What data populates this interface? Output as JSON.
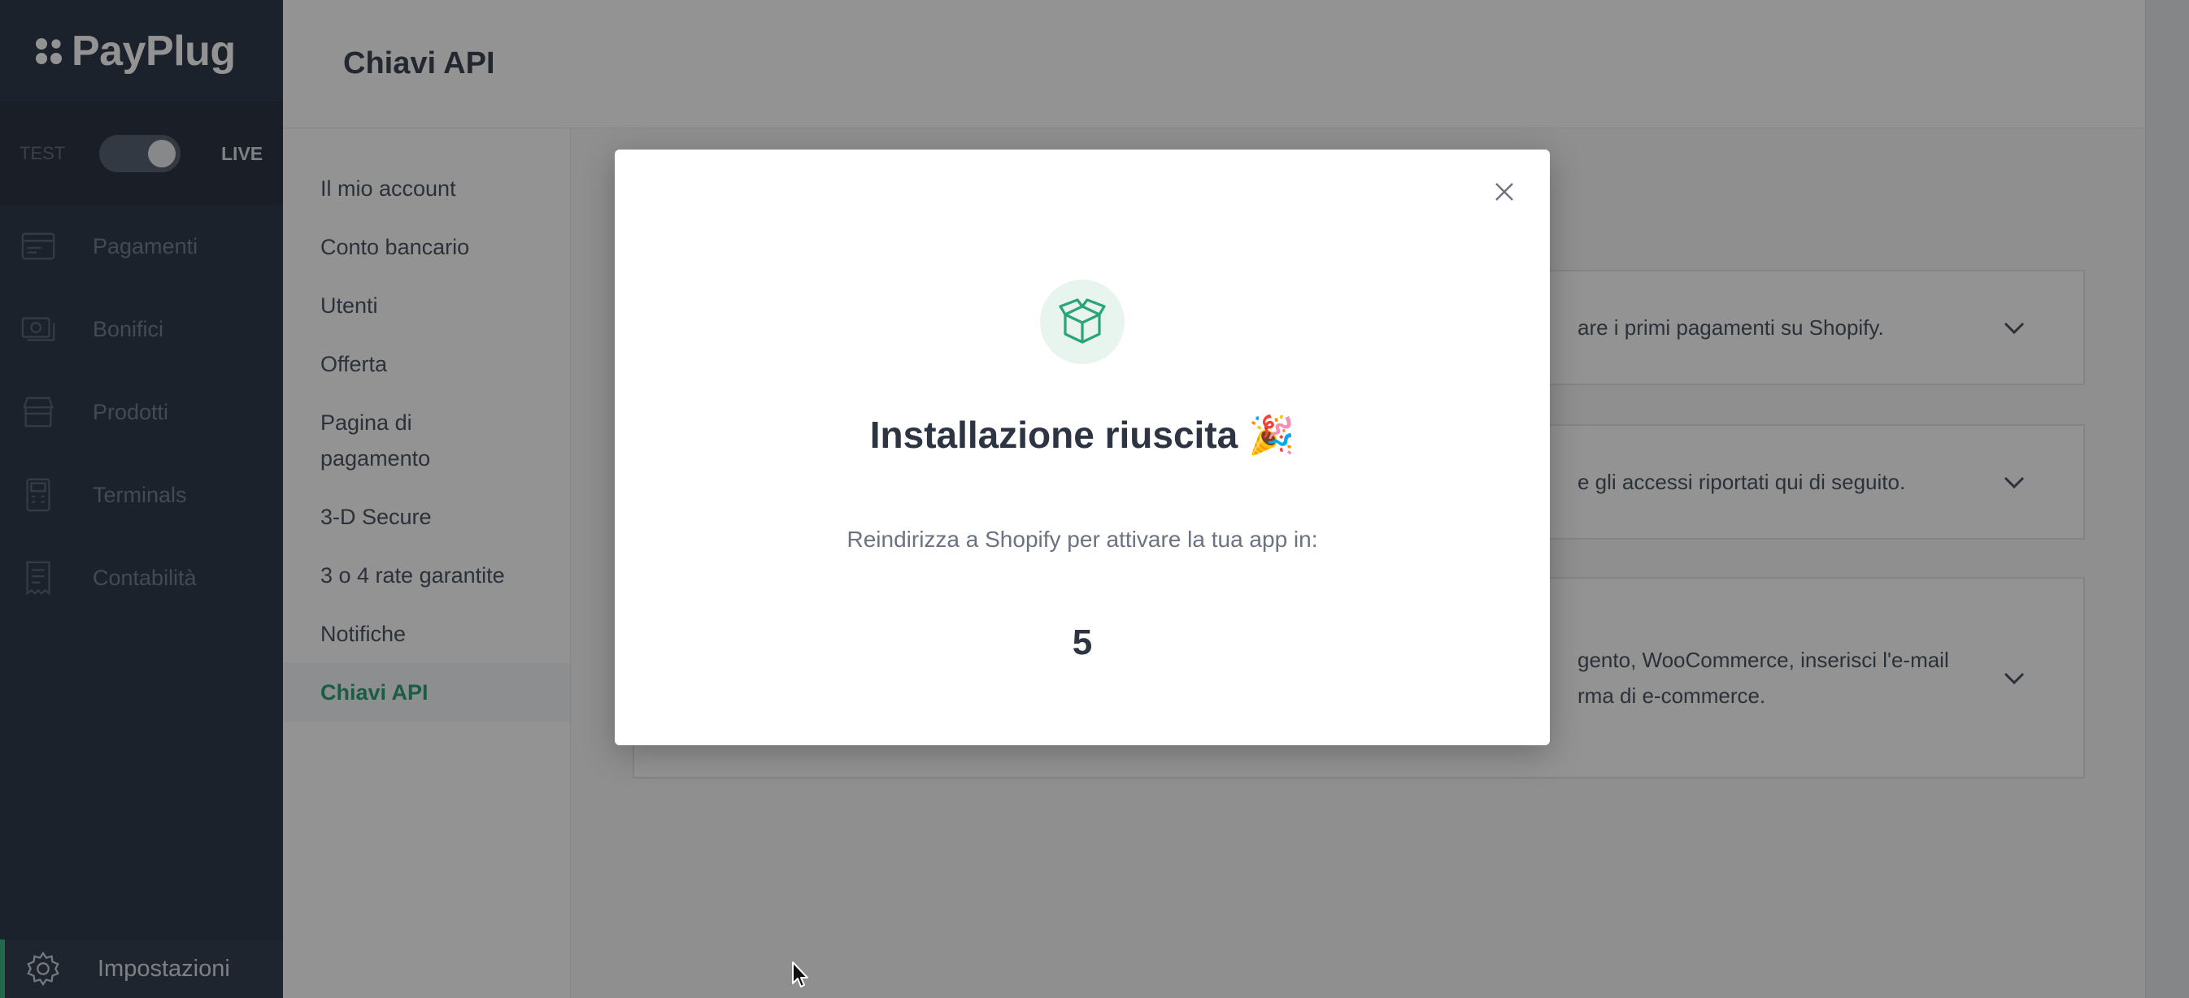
{
  "brand": {
    "name": "PayPlug"
  },
  "mode_toggle": {
    "test_label": "TEST",
    "live_label": "LIVE",
    "state": "live"
  },
  "sidebar": {
    "items": [
      {
        "label": "Pagamenti",
        "icon": "card-icon"
      },
      {
        "label": "Bonifici",
        "icon": "money-transfer-icon"
      },
      {
        "label": "Prodotti",
        "icon": "store-icon"
      },
      {
        "label": "Terminals",
        "icon": "terminal-icon"
      },
      {
        "label": "Contabilità",
        "icon": "receipt-icon"
      }
    ],
    "settings": {
      "label": "Impostazioni",
      "icon": "gear-icon"
    }
  },
  "header": {
    "title": "Chiavi API"
  },
  "submenu": {
    "items": [
      {
        "label": "Il mio account"
      },
      {
        "label": "Conto bancario"
      },
      {
        "label": "Utenti"
      },
      {
        "label": "Offerta"
      },
      {
        "label": "Pagina di pagamento"
      },
      {
        "label": "3-D Secure"
      },
      {
        "label": "3 o 4 rate garantite"
      },
      {
        "label": "Notifiche"
      },
      {
        "label": "Chiavi API",
        "active": true
      }
    ]
  },
  "panels": [
    {
      "text": "are i primi pagamenti su Shopify."
    },
    {
      "text": "e gli accessi riportati qui di seguito."
    },
    {
      "text_line1": "gento, WooCommerce, inserisci l'e-mail",
      "text_line2": "rma di e-commerce."
    }
  ],
  "modal": {
    "icon": "package-box-icon",
    "title": "Installazione riuscita 🎉",
    "subtitle": "Reindirizza a Shopify per attivare la tua app in:",
    "countdown": "5"
  },
  "colors": {
    "sidebar_bg": "#1f2a3b",
    "accent_green": "#1e9a68",
    "overlay": "rgba(25,25,25,0.47)"
  }
}
